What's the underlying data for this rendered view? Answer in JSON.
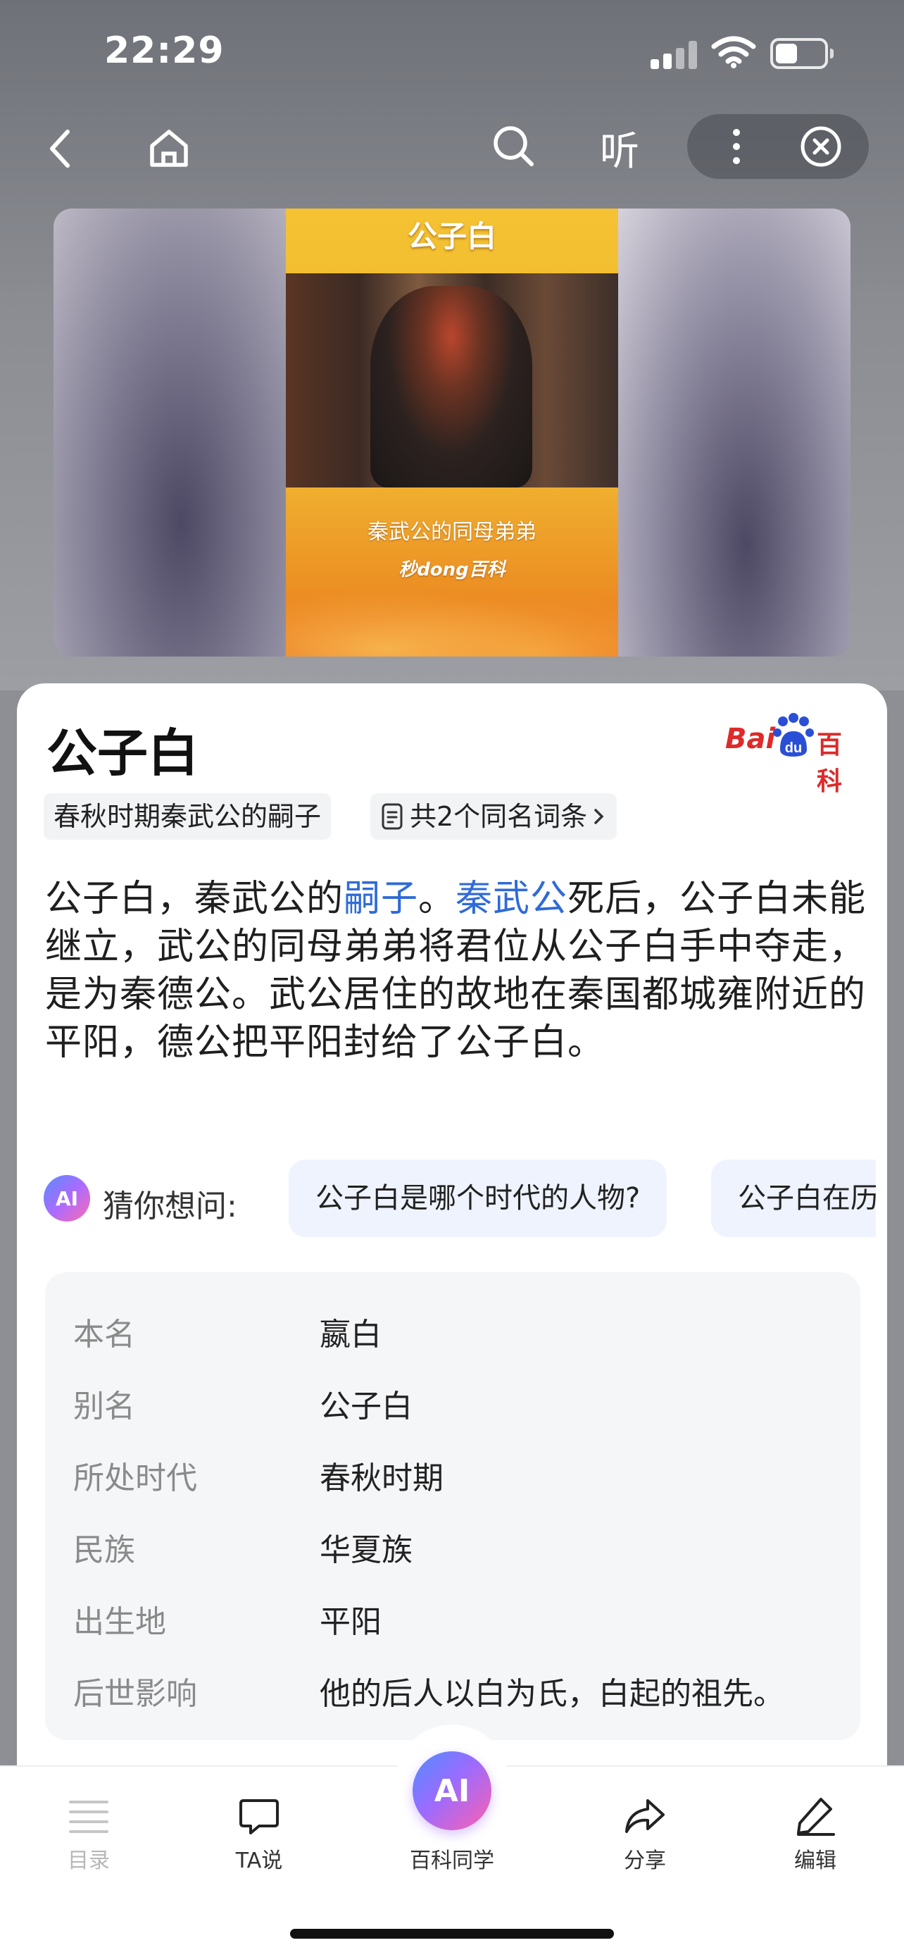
{
  "status_bar": {
    "time": "22:29",
    "battery_level": 0.45
  },
  "nav": {
    "listen_label": "听"
  },
  "hero": {
    "poster_title": "公子白",
    "poster_caption": "秦武公的同母弟弟",
    "poster_brand": "秒dong百科"
  },
  "article": {
    "title": "公子白",
    "logo_bai": "Bai",
    "logo_baike": "百科",
    "subtitle_chip": "春秋时期秦武公的嗣子",
    "homonym_chip": "共2个同名词条",
    "summary": {
      "p1": "公子白，秦武公的",
      "link1": "嗣子",
      "p2": "。",
      "link2": "秦武公",
      "p3": "死后，公子白未能继立，武公的同母弟弟将君位从公子白手中夺走，是为秦德公。武公居住的故地在秦国都城雍附近的平阳，德公把平阳封给了公子白。"
    },
    "guess": {
      "badge": "AI",
      "label": "猜你想问:",
      "questions": [
        "公子白是哪个时代的人物?",
        "公子白在历"
      ]
    },
    "infobox": [
      {
        "key": "本名",
        "value": "嬴白"
      },
      {
        "key": "别名",
        "value": "公子白"
      },
      {
        "key": "所处时代",
        "value": "春秋时期"
      },
      {
        "key": "民族",
        "value": "华夏族"
      },
      {
        "key": "出生地",
        "value": "平阳"
      },
      {
        "key": "后世影响",
        "value": "他的后人以白为氏，白起的祖先。"
      }
    ]
  },
  "bottom_nav": {
    "catalog": "目录",
    "ta_says": "TA说",
    "ai_badge": "AI",
    "classmate": "百科同学",
    "share": "分享",
    "edit": "编辑"
  },
  "colors": {
    "link": "#2f6bd6",
    "brand_red": "#de2a2a"
  }
}
